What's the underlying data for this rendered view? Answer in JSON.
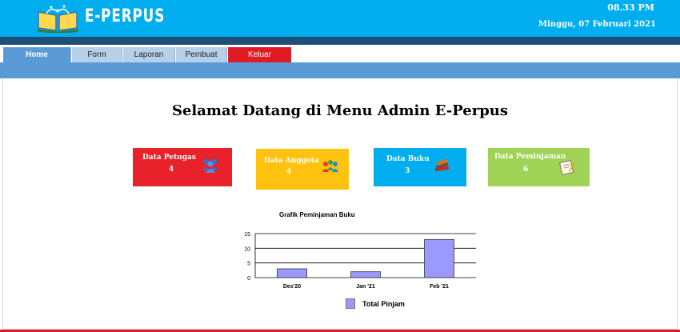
{
  "header": {
    "brand": "E-PERPUS",
    "time": "08.33 PM",
    "date": "Minggu, 07 Februari 2021"
  },
  "nav": {
    "tabs": [
      {
        "label": "Home"
      },
      {
        "label": "Form"
      },
      {
        "label": "Laporan"
      },
      {
        "label": "Pembuat"
      },
      {
        "label": "Keluar"
      }
    ]
  },
  "main": {
    "title": "Selamat Datang di Menu Admin E-Perpus",
    "cards": [
      {
        "label": "Data Petugas",
        "value": "4",
        "icon": "users-icon",
        "color": "#e8212a"
      },
      {
        "label": "Data Anggota",
        "value": "4",
        "icon": "members-icon",
        "color": "#ffc20e"
      },
      {
        "label": "Data Buku",
        "value": "3",
        "icon": "books-icon",
        "color": "#00aeef"
      },
      {
        "label": "Data Peminjaman",
        "value": "6",
        "icon": "loan-icon",
        "color": "#9fd356"
      }
    ]
  },
  "chart_data": {
    "type": "bar",
    "title": "Grafik Peminjaman Buku",
    "categories": [
      "Des'20",
      "Jan '21",
      "Feb '21"
    ],
    "series": [
      {
        "name": "Total Pinjam",
        "values": [
          3,
          2,
          13
        ],
        "color": "#9999ff"
      }
    ],
    "ylim": [
      0,
      15
    ],
    "yticks": [
      0,
      5,
      10,
      15
    ],
    "grid": true,
    "legend": "bottom"
  }
}
